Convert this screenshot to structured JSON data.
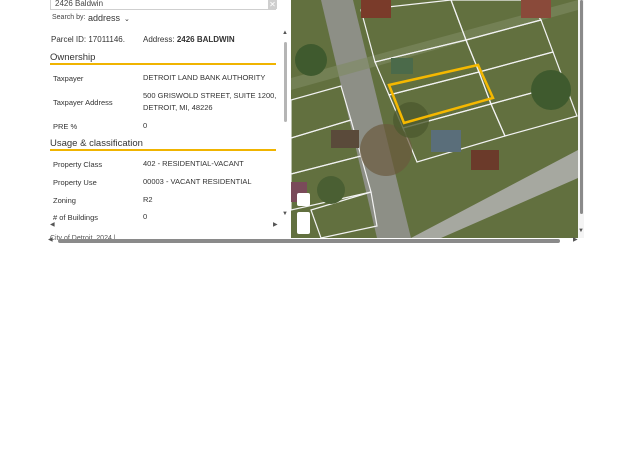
{
  "search": {
    "value": "2426 Baldwin",
    "clear_icon": "close-icon"
  },
  "search_by": {
    "label": "Search by:",
    "value": "address"
  },
  "parcel": {
    "id_label": "Parcel ID: 17011146.",
    "address_label": "Address:",
    "address_value": "2426 BALDWIN"
  },
  "sections": {
    "ownership": {
      "title": "Ownership",
      "rows": [
        {
          "label": "Taxpayer",
          "value": "DETROIT LAND BANK AUTHORITY"
        },
        {
          "label": "Taxpayer Address",
          "value_line1": "500 GRISWOLD STREET, SUITE 1200,",
          "value_line2": "DETROIT, MI, 48226"
        },
        {
          "label": "PRE %",
          "value": "0"
        }
      ]
    },
    "usage": {
      "title": "Usage & classification",
      "rows": [
        {
          "label": "Property Class",
          "value": "402 - RESIDENTIAL-VACANT"
        },
        {
          "label": "Property Use",
          "value": "00003 - VACANT RESIDENTIAL"
        },
        {
          "label": "Zoning",
          "value": "R2"
        },
        {
          "label": "# of Buildings",
          "value": "0"
        }
      ]
    }
  },
  "attribution": "City of Detroit, 2024 | ...",
  "colors": {
    "accent": "#f0b400",
    "highlight": "#f5b800"
  }
}
